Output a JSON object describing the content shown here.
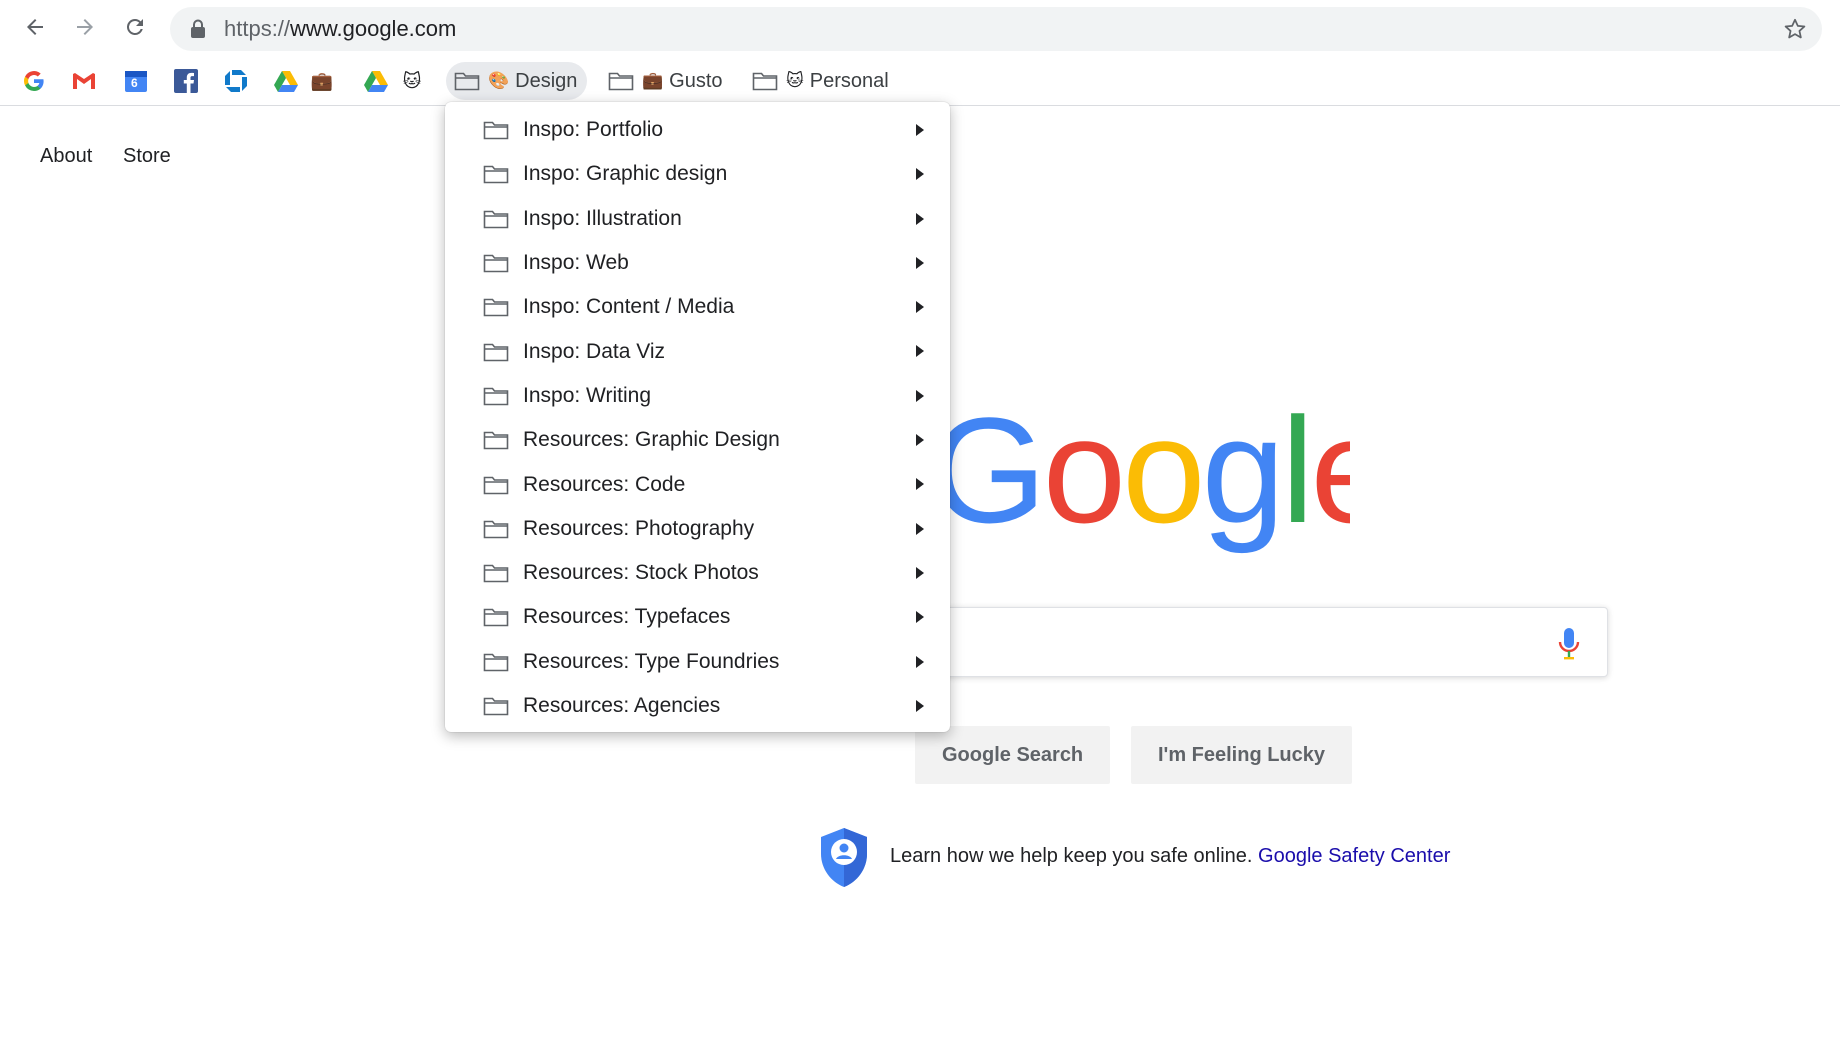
{
  "browser": {
    "url_scheme": "https://",
    "url_host": "www.google.com",
    "nav": {
      "back_icon": "arrow-back-icon",
      "forward_icon": "arrow-forward-icon",
      "reload_icon": "reload-icon"
    }
  },
  "bookmarks": {
    "icons": [
      "google-icon",
      "gmail-icon",
      "calendar-icon",
      "facebook-icon",
      "chase-icon",
      "drive-icon",
      "briefcase-icon",
      "drive-icon",
      "emoji-icon"
    ],
    "calendar_day": "6",
    "folders": [
      {
        "label": "Design",
        "emoji": "🎨",
        "active": true
      },
      {
        "label": "Gusto",
        "emoji": "💼",
        "active": false
      },
      {
        "label": "Personal",
        "emoji": "🐱",
        "active": false
      }
    ]
  },
  "page": {
    "top_links": [
      "About",
      "Store"
    ],
    "logo_letters": [
      "G",
      "o",
      "o",
      "g",
      "l",
      "e"
    ],
    "logo_colors": [
      "#4285F4",
      "#EA4335",
      "#FBBC05",
      "#4285F4",
      "#34A853",
      "#EA4335"
    ],
    "search_placeholder": "",
    "buttons": [
      "Google Search",
      "I'm Feeling Lucky"
    ],
    "safety_text": "Learn how we help keep you safe online.",
    "safety_link": "Google Safety Center"
  },
  "design_menu": {
    "items": [
      "Inspo: Portfolio",
      "Inspo: Graphic design",
      "Inspo: Illustration",
      "Inspo: Web",
      "Inspo: Content / Media",
      "Inspo: Data Viz",
      "Inspo: Writing",
      "Resources: Graphic Design",
      "Resources: Code",
      "Resources: Photography",
      "Resources: Stock Photos",
      "Resources: Typefaces",
      "Resources: Type Foundries",
      "Resources: Agencies"
    ]
  }
}
